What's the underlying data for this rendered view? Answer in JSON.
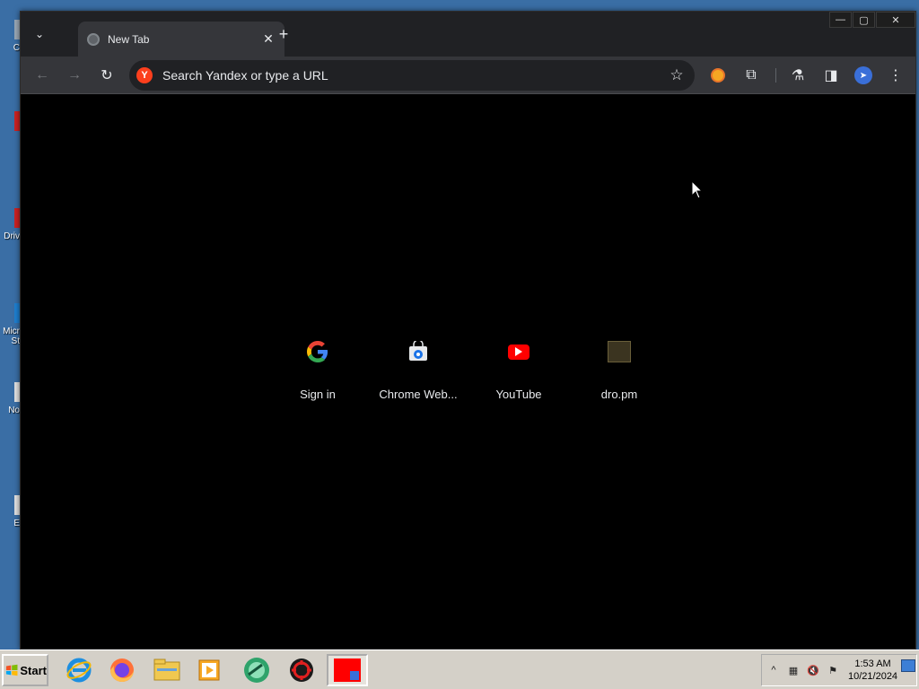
{
  "desktop": {
    "icons": [
      {
        "label": "C",
        "color": "#888888"
      },
      {
        "label": "",
        "color": "#cc2222"
      },
      {
        "label": "Driv",
        "color": "#cc2222"
      },
      {
        "label": "Micr\nSt",
        "color": "#1e7fd0"
      },
      {
        "label": "No",
        "color": "#dddddd"
      },
      {
        "label": "E",
        "color": "#dddddd"
      }
    ]
  },
  "window": {
    "tab": {
      "title": "New Tab",
      "favicon": "chrome-favicon-icon",
      "close_symbol": "✕"
    },
    "tab_search_symbol": "⌄",
    "new_tab_symbol": "+",
    "controls": {
      "minimize": "—",
      "maximize": "▢",
      "close": "✕"
    }
  },
  "toolbar": {
    "back_symbol": "←",
    "forward_symbol": "→",
    "reload_symbol": "↻",
    "omnibox": {
      "search_engine_badge": "Y",
      "placeholder": "Search Yandex or type a URL"
    },
    "bookmark_symbol": "☆",
    "extensions": [
      "bitcoin-extension-icon",
      "puzzle-extensions-icon",
      "labs-icon",
      "side-panel-icon",
      "profile-avatar-icon",
      "menu-icon"
    ],
    "extension_symbols": {
      "puzzle": "⧉",
      "labs": "⚗",
      "side_panel": "◨",
      "menu": "⋮"
    }
  },
  "shortcuts": [
    {
      "label": "Sign in",
      "icon": "google-icon"
    },
    {
      "label": "Chrome Web...",
      "icon": "chrome-web-store-icon"
    },
    {
      "label": "YouTube",
      "icon": "youtube-icon"
    },
    {
      "label": "dro.pm",
      "icon": "dro-pm-icon"
    }
  ],
  "taskbar": {
    "start_label": "Start",
    "apps": [
      "internet-explorer-icon",
      "firefox-icon",
      "file-explorer-icon",
      "media-player-icon",
      "greenshot-icon",
      "app-red-icon",
      "active-window-icon"
    ],
    "tray": {
      "time": "1:53 AM",
      "date": "10/21/2024"
    }
  }
}
